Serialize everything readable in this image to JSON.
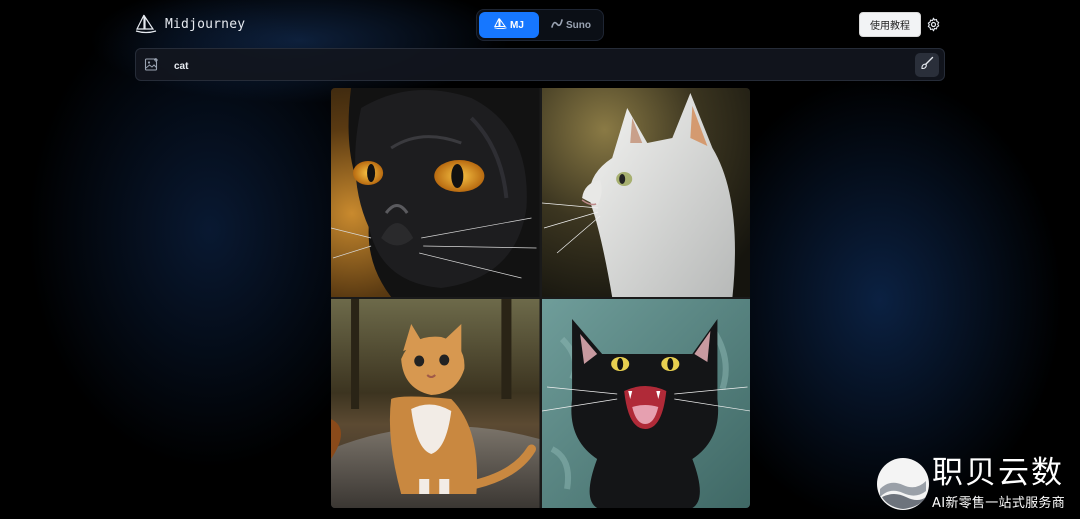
{
  "header": {
    "app_name": "Midjourney",
    "tabs": [
      {
        "label": "MJ",
        "active": true
      },
      {
        "label": "Suno",
        "active": false
      }
    ],
    "help_label": "使用教程",
    "accent_color": "#1677ff"
  },
  "prompt": {
    "value": "cat"
  },
  "grid": {
    "images": [
      {
        "subject": "black cat with amber eyes, close-up painting"
      },
      {
        "subject": "white cat in profile looking up"
      },
      {
        "subject": "orange and white kitten sitting on path"
      },
      {
        "subject": "black cat yowling on teal background"
      }
    ]
  },
  "watermark": {
    "title": "职贝云数",
    "subtitle": "AI新零售一站式服务商"
  }
}
